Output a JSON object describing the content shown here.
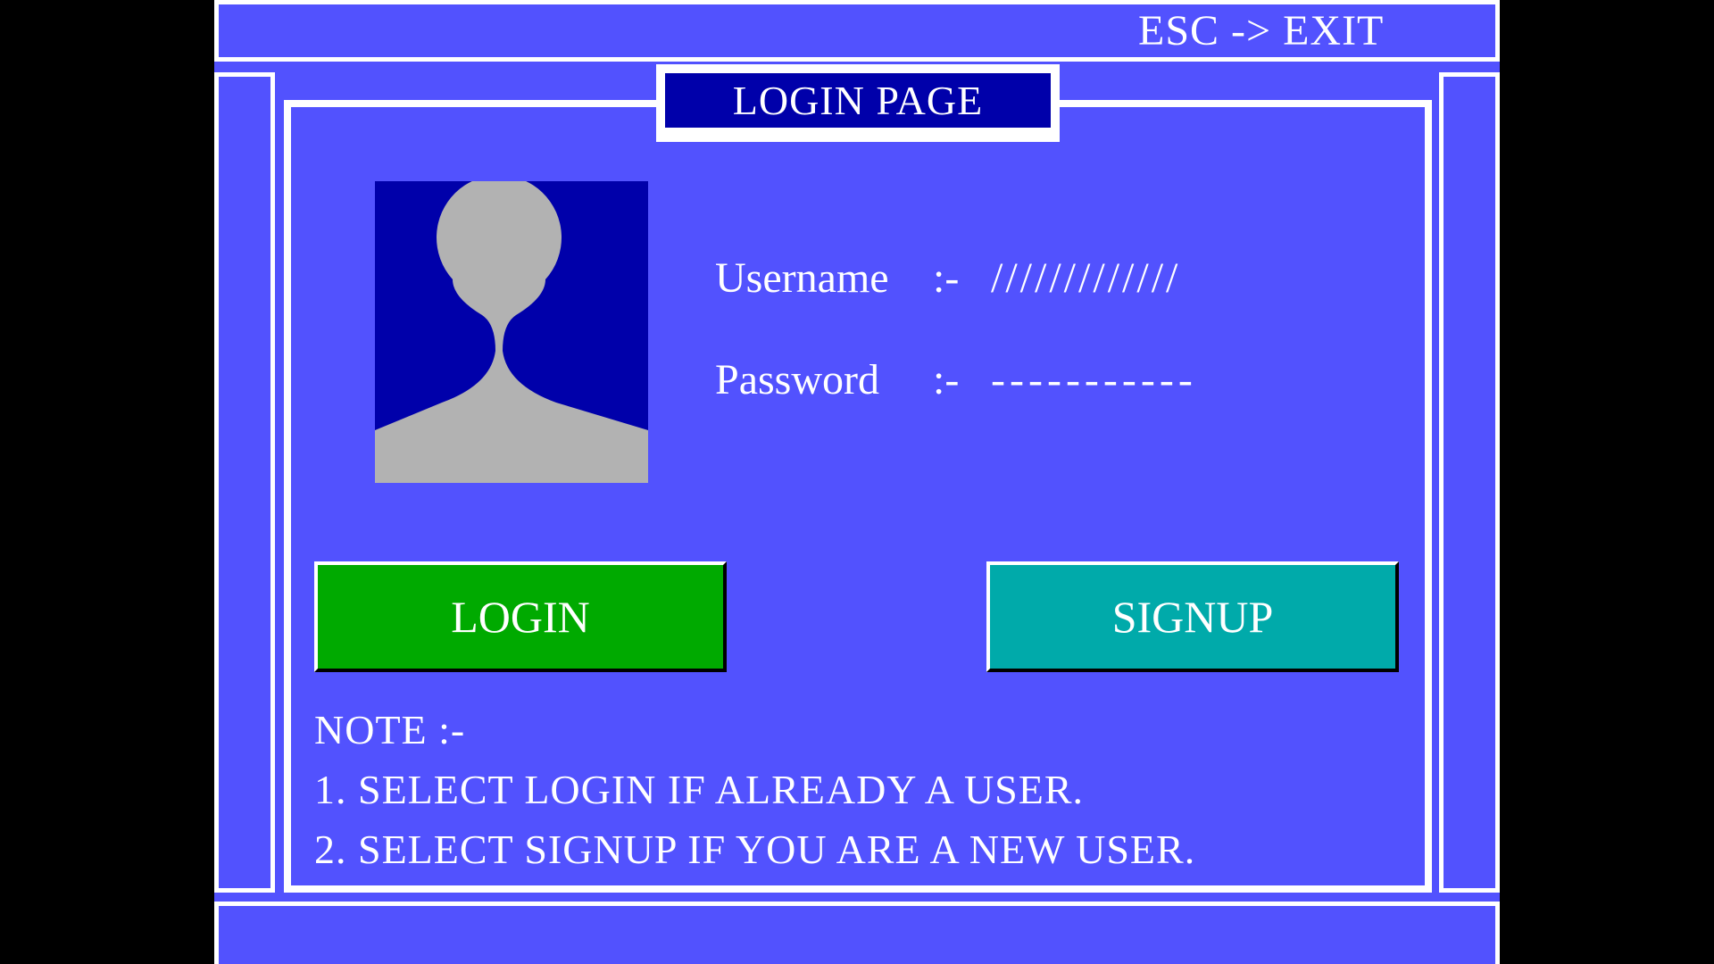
{
  "header": {
    "exit_hint": "ESC -> EXIT"
  },
  "title": "LOGIN PAGE",
  "avatar": {
    "icon": "user-silhouette-icon",
    "bg_color": "#0000aa",
    "figure_color": "#b2b2b2"
  },
  "form": {
    "username": {
      "label": "Username",
      "separator": ":-",
      "value": "/////////////"
    },
    "password": {
      "label": "Password",
      "separator": ":-",
      "value": "-----------"
    }
  },
  "buttons": {
    "login": {
      "label": "LOGIN",
      "color": "#00aa00"
    },
    "signup": {
      "label": "SIGNUP",
      "color": "#00aaaa"
    }
  },
  "note": {
    "heading": "NOTE :-",
    "lines": [
      "1. SELECT LOGIN IF ALREADY A USER.",
      "2. SELECT SIGNUP IF YOU ARE A NEW USER."
    ]
  },
  "colors": {
    "screen_bg": "#5252fe",
    "frame": "#ffffff",
    "title_bg": "#0000aa"
  }
}
